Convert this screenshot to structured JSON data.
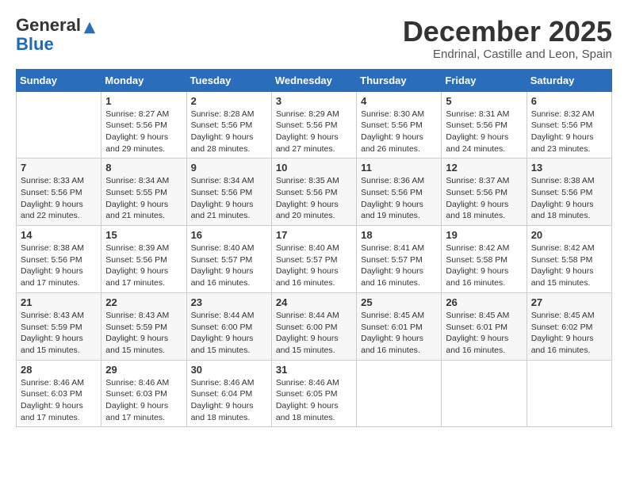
{
  "logo": {
    "general": "General",
    "blue": "Blue"
  },
  "title": "December 2025",
  "subtitle": "Endrinal, Castille and Leon, Spain",
  "weekdays": [
    "Sunday",
    "Monday",
    "Tuesday",
    "Wednesday",
    "Thursday",
    "Friday",
    "Saturday"
  ],
  "weeks": [
    [
      {
        "num": "",
        "sunrise": "",
        "sunset": "",
        "daylight": ""
      },
      {
        "num": "1",
        "sunrise": "Sunrise: 8:27 AM",
        "sunset": "Sunset: 5:56 PM",
        "daylight": "Daylight: 9 hours and 29 minutes."
      },
      {
        "num": "2",
        "sunrise": "Sunrise: 8:28 AM",
        "sunset": "Sunset: 5:56 PM",
        "daylight": "Daylight: 9 hours and 28 minutes."
      },
      {
        "num": "3",
        "sunrise": "Sunrise: 8:29 AM",
        "sunset": "Sunset: 5:56 PM",
        "daylight": "Daylight: 9 hours and 27 minutes."
      },
      {
        "num": "4",
        "sunrise": "Sunrise: 8:30 AM",
        "sunset": "Sunset: 5:56 PM",
        "daylight": "Daylight: 9 hours and 26 minutes."
      },
      {
        "num": "5",
        "sunrise": "Sunrise: 8:31 AM",
        "sunset": "Sunset: 5:56 PM",
        "daylight": "Daylight: 9 hours and 24 minutes."
      },
      {
        "num": "6",
        "sunrise": "Sunrise: 8:32 AM",
        "sunset": "Sunset: 5:56 PM",
        "daylight": "Daylight: 9 hours and 23 minutes."
      }
    ],
    [
      {
        "num": "7",
        "sunrise": "Sunrise: 8:33 AM",
        "sunset": "Sunset: 5:56 PM",
        "daylight": "Daylight: 9 hours and 22 minutes."
      },
      {
        "num": "8",
        "sunrise": "Sunrise: 8:34 AM",
        "sunset": "Sunset: 5:55 PM",
        "daylight": "Daylight: 9 hours and 21 minutes."
      },
      {
        "num": "9",
        "sunrise": "Sunrise: 8:34 AM",
        "sunset": "Sunset: 5:56 PM",
        "daylight": "Daylight: 9 hours and 21 minutes."
      },
      {
        "num": "10",
        "sunrise": "Sunrise: 8:35 AM",
        "sunset": "Sunset: 5:56 PM",
        "daylight": "Daylight: 9 hours and 20 minutes."
      },
      {
        "num": "11",
        "sunrise": "Sunrise: 8:36 AM",
        "sunset": "Sunset: 5:56 PM",
        "daylight": "Daylight: 9 hours and 19 minutes."
      },
      {
        "num": "12",
        "sunrise": "Sunrise: 8:37 AM",
        "sunset": "Sunset: 5:56 PM",
        "daylight": "Daylight: 9 hours and 18 minutes."
      },
      {
        "num": "13",
        "sunrise": "Sunrise: 8:38 AM",
        "sunset": "Sunset: 5:56 PM",
        "daylight": "Daylight: 9 hours and 18 minutes."
      }
    ],
    [
      {
        "num": "14",
        "sunrise": "Sunrise: 8:38 AM",
        "sunset": "Sunset: 5:56 PM",
        "daylight": "Daylight: 9 hours and 17 minutes."
      },
      {
        "num": "15",
        "sunrise": "Sunrise: 8:39 AM",
        "sunset": "Sunset: 5:56 PM",
        "daylight": "Daylight: 9 hours and 17 minutes."
      },
      {
        "num": "16",
        "sunrise": "Sunrise: 8:40 AM",
        "sunset": "Sunset: 5:57 PM",
        "daylight": "Daylight: 9 hours and 16 minutes."
      },
      {
        "num": "17",
        "sunrise": "Sunrise: 8:40 AM",
        "sunset": "Sunset: 5:57 PM",
        "daylight": "Daylight: 9 hours and 16 minutes."
      },
      {
        "num": "18",
        "sunrise": "Sunrise: 8:41 AM",
        "sunset": "Sunset: 5:57 PM",
        "daylight": "Daylight: 9 hours and 16 minutes."
      },
      {
        "num": "19",
        "sunrise": "Sunrise: 8:42 AM",
        "sunset": "Sunset: 5:58 PM",
        "daylight": "Daylight: 9 hours and 16 minutes."
      },
      {
        "num": "20",
        "sunrise": "Sunrise: 8:42 AM",
        "sunset": "Sunset: 5:58 PM",
        "daylight": "Daylight: 9 hours and 15 minutes."
      }
    ],
    [
      {
        "num": "21",
        "sunrise": "Sunrise: 8:43 AM",
        "sunset": "Sunset: 5:59 PM",
        "daylight": "Daylight: 9 hours and 15 minutes."
      },
      {
        "num": "22",
        "sunrise": "Sunrise: 8:43 AM",
        "sunset": "Sunset: 5:59 PM",
        "daylight": "Daylight: 9 hours and 15 minutes."
      },
      {
        "num": "23",
        "sunrise": "Sunrise: 8:44 AM",
        "sunset": "Sunset: 6:00 PM",
        "daylight": "Daylight: 9 hours and 15 minutes."
      },
      {
        "num": "24",
        "sunrise": "Sunrise: 8:44 AM",
        "sunset": "Sunset: 6:00 PM",
        "daylight": "Daylight: 9 hours and 15 minutes."
      },
      {
        "num": "25",
        "sunrise": "Sunrise: 8:45 AM",
        "sunset": "Sunset: 6:01 PM",
        "daylight": "Daylight: 9 hours and 16 minutes."
      },
      {
        "num": "26",
        "sunrise": "Sunrise: 8:45 AM",
        "sunset": "Sunset: 6:01 PM",
        "daylight": "Daylight: 9 hours and 16 minutes."
      },
      {
        "num": "27",
        "sunrise": "Sunrise: 8:45 AM",
        "sunset": "Sunset: 6:02 PM",
        "daylight": "Daylight: 9 hours and 16 minutes."
      }
    ],
    [
      {
        "num": "28",
        "sunrise": "Sunrise: 8:46 AM",
        "sunset": "Sunset: 6:03 PM",
        "daylight": "Daylight: 9 hours and 17 minutes."
      },
      {
        "num": "29",
        "sunrise": "Sunrise: 8:46 AM",
        "sunset": "Sunset: 6:03 PM",
        "daylight": "Daylight: 9 hours and 17 minutes."
      },
      {
        "num": "30",
        "sunrise": "Sunrise: 8:46 AM",
        "sunset": "Sunset: 6:04 PM",
        "daylight": "Daylight: 9 hours and 18 minutes."
      },
      {
        "num": "31",
        "sunrise": "Sunrise: 8:46 AM",
        "sunset": "Sunset: 6:05 PM",
        "daylight": "Daylight: 9 hours and 18 minutes."
      },
      {
        "num": "",
        "sunrise": "",
        "sunset": "",
        "daylight": ""
      },
      {
        "num": "",
        "sunrise": "",
        "sunset": "",
        "daylight": ""
      },
      {
        "num": "",
        "sunrise": "",
        "sunset": "",
        "daylight": ""
      }
    ]
  ]
}
